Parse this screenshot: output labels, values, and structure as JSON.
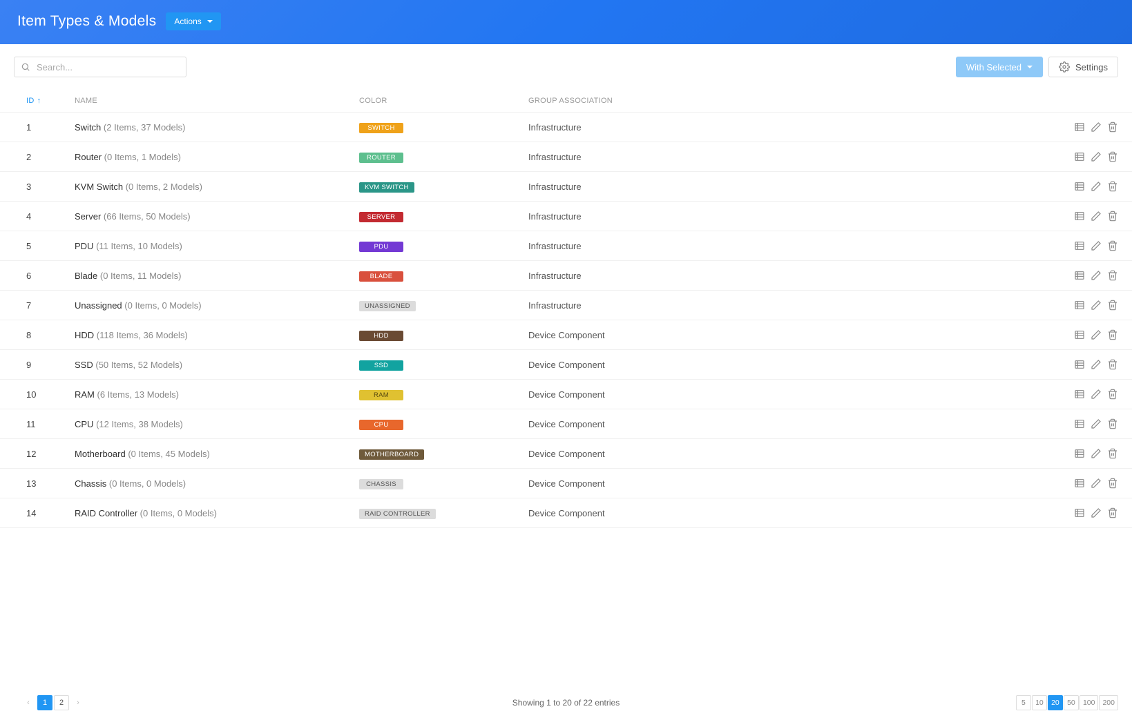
{
  "header": {
    "title": "Item Types & Models",
    "actions_label": "Actions"
  },
  "toolbar": {
    "search_placeholder": "Search...",
    "with_selected_label": "With Selected",
    "settings_label": "Settings"
  },
  "columns": {
    "id": "ID",
    "name": "NAME",
    "color": "COLOR",
    "group": "GROUP ASSOCIATION"
  },
  "rows": [
    {
      "id": "1",
      "name": "Switch",
      "counts": "(2 Items, 37 Models)",
      "tag": "SWITCH",
      "tag_bg": "#efa21a",
      "tag_fg": "#fff",
      "group": "Infrastructure"
    },
    {
      "id": "2",
      "name": "Router",
      "counts": "(0 Items, 1 Models)",
      "tag": "ROUTER",
      "tag_bg": "#5dbf8e",
      "tag_fg": "#fff",
      "group": "Infrastructure"
    },
    {
      "id": "3",
      "name": "KVM Switch",
      "counts": "(0 Items, 2 Models)",
      "tag": "KVM SWITCH",
      "tag_bg": "#2b9688",
      "tag_fg": "#fff",
      "group": "Infrastructure"
    },
    {
      "id": "4",
      "name": "Server",
      "counts": "(66 Items, 50 Models)",
      "tag": "SERVER",
      "tag_bg": "#c32a31",
      "tag_fg": "#fff",
      "group": "Infrastructure"
    },
    {
      "id": "5",
      "name": "PDU",
      "counts": "(11 Items, 10 Models)",
      "tag": "PDU",
      "tag_bg": "#7339d4",
      "tag_fg": "#fff",
      "group": "Infrastructure"
    },
    {
      "id": "6",
      "name": "Blade",
      "counts": "(0 Items, 11 Models)",
      "tag": "BLADE",
      "tag_bg": "#d9503d",
      "tag_fg": "#fff",
      "group": "Infrastructure"
    },
    {
      "id": "7",
      "name": "Unassigned",
      "counts": "(0 Items, 0 Models)",
      "tag": "UNASSIGNED",
      "tag_bg": "#dcdcdc",
      "tag_fg": "#555",
      "group": "Infrastructure"
    },
    {
      "id": "8",
      "name": "HDD",
      "counts": "(118 Items, 36 Models)",
      "tag": "HDD",
      "tag_bg": "#6a4a33",
      "tag_fg": "#fff",
      "group": "Device Component"
    },
    {
      "id": "9",
      "name": "SSD",
      "counts": "(50 Items, 52 Models)",
      "tag": "SSD",
      "tag_bg": "#12a3a0",
      "tag_fg": "#fff",
      "group": "Device Component"
    },
    {
      "id": "10",
      "name": "RAM",
      "counts": "(6 Items, 13 Models)",
      "tag": "RAM",
      "tag_bg": "#e0c131",
      "tag_fg": "#5a4b10",
      "group": "Device Component"
    },
    {
      "id": "11",
      "name": "CPU",
      "counts": "(12 Items, 38 Models)",
      "tag": "CPU",
      "tag_bg": "#e8672c",
      "tag_fg": "#fff",
      "group": "Device Component"
    },
    {
      "id": "12",
      "name": "Motherboard",
      "counts": "(0 Items, 45 Models)",
      "tag": "MOTHERBOARD",
      "tag_bg": "#6f5a3b",
      "tag_fg": "#fff",
      "group": "Device Component"
    },
    {
      "id": "13",
      "name": "Chassis",
      "counts": "(0 Items, 0 Models)",
      "tag": "CHASSIS",
      "tag_bg": "#dcdcdc",
      "tag_fg": "#555",
      "group": "Device Component"
    },
    {
      "id": "14",
      "name": "RAID Controller",
      "counts": "(0 Items, 0 Models)",
      "tag": "RAID CONTROLLER",
      "tag_bg": "#dcdcdc",
      "tag_fg": "#555",
      "group": "Device Component"
    }
  ],
  "footer": {
    "entries_text": "Showing 1 to 20 of 22 entries",
    "pages": [
      "1",
      "2"
    ],
    "active_page": "1",
    "page_sizes": [
      "5",
      "10",
      "20",
      "50",
      "100",
      "200"
    ],
    "active_page_size": "20"
  }
}
